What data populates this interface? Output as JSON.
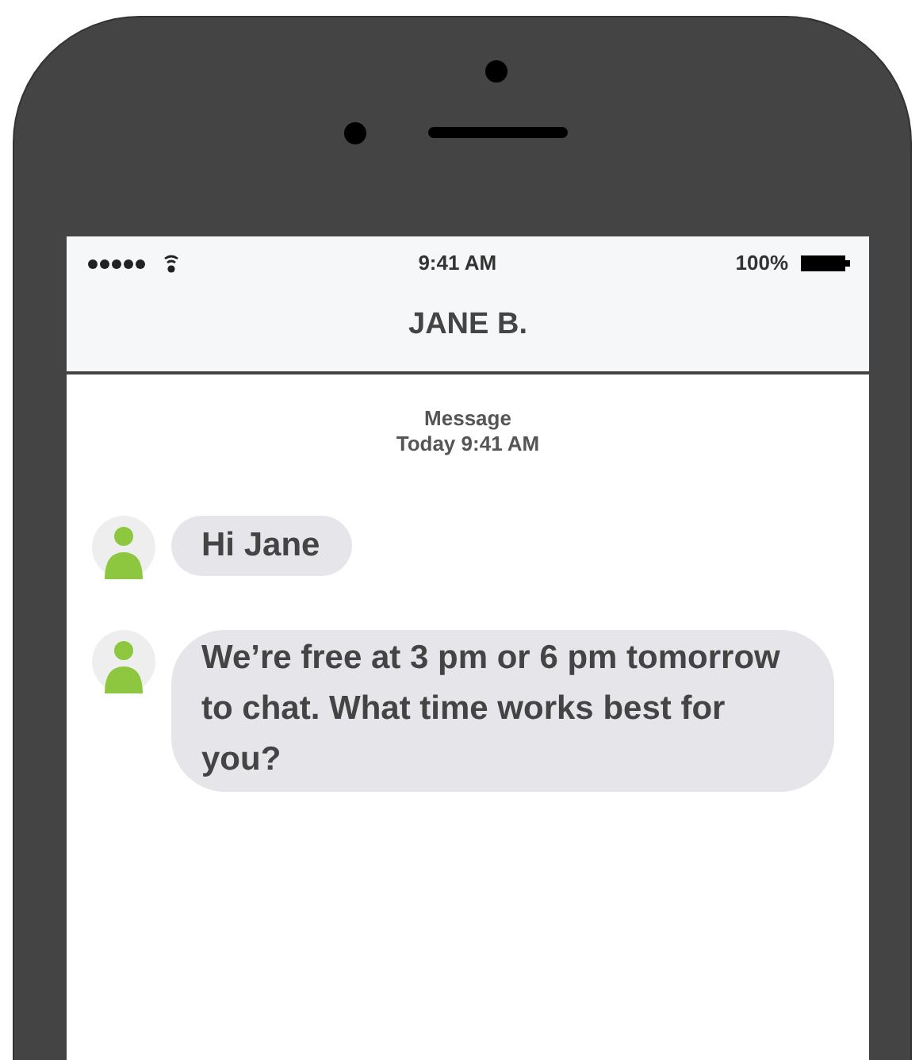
{
  "status_bar": {
    "time": "9:41 AM",
    "battery": "100%"
  },
  "header": {
    "title": "JANE B."
  },
  "thread_info": {
    "label": "Message",
    "time": "Today 9:41 AM"
  },
  "messages": [
    {
      "text": "Hi Jane"
    },
    {
      "text": "We’re free at 3 pm or 6 pm tomorrow to chat. What time works best for you?"
    }
  ]
}
